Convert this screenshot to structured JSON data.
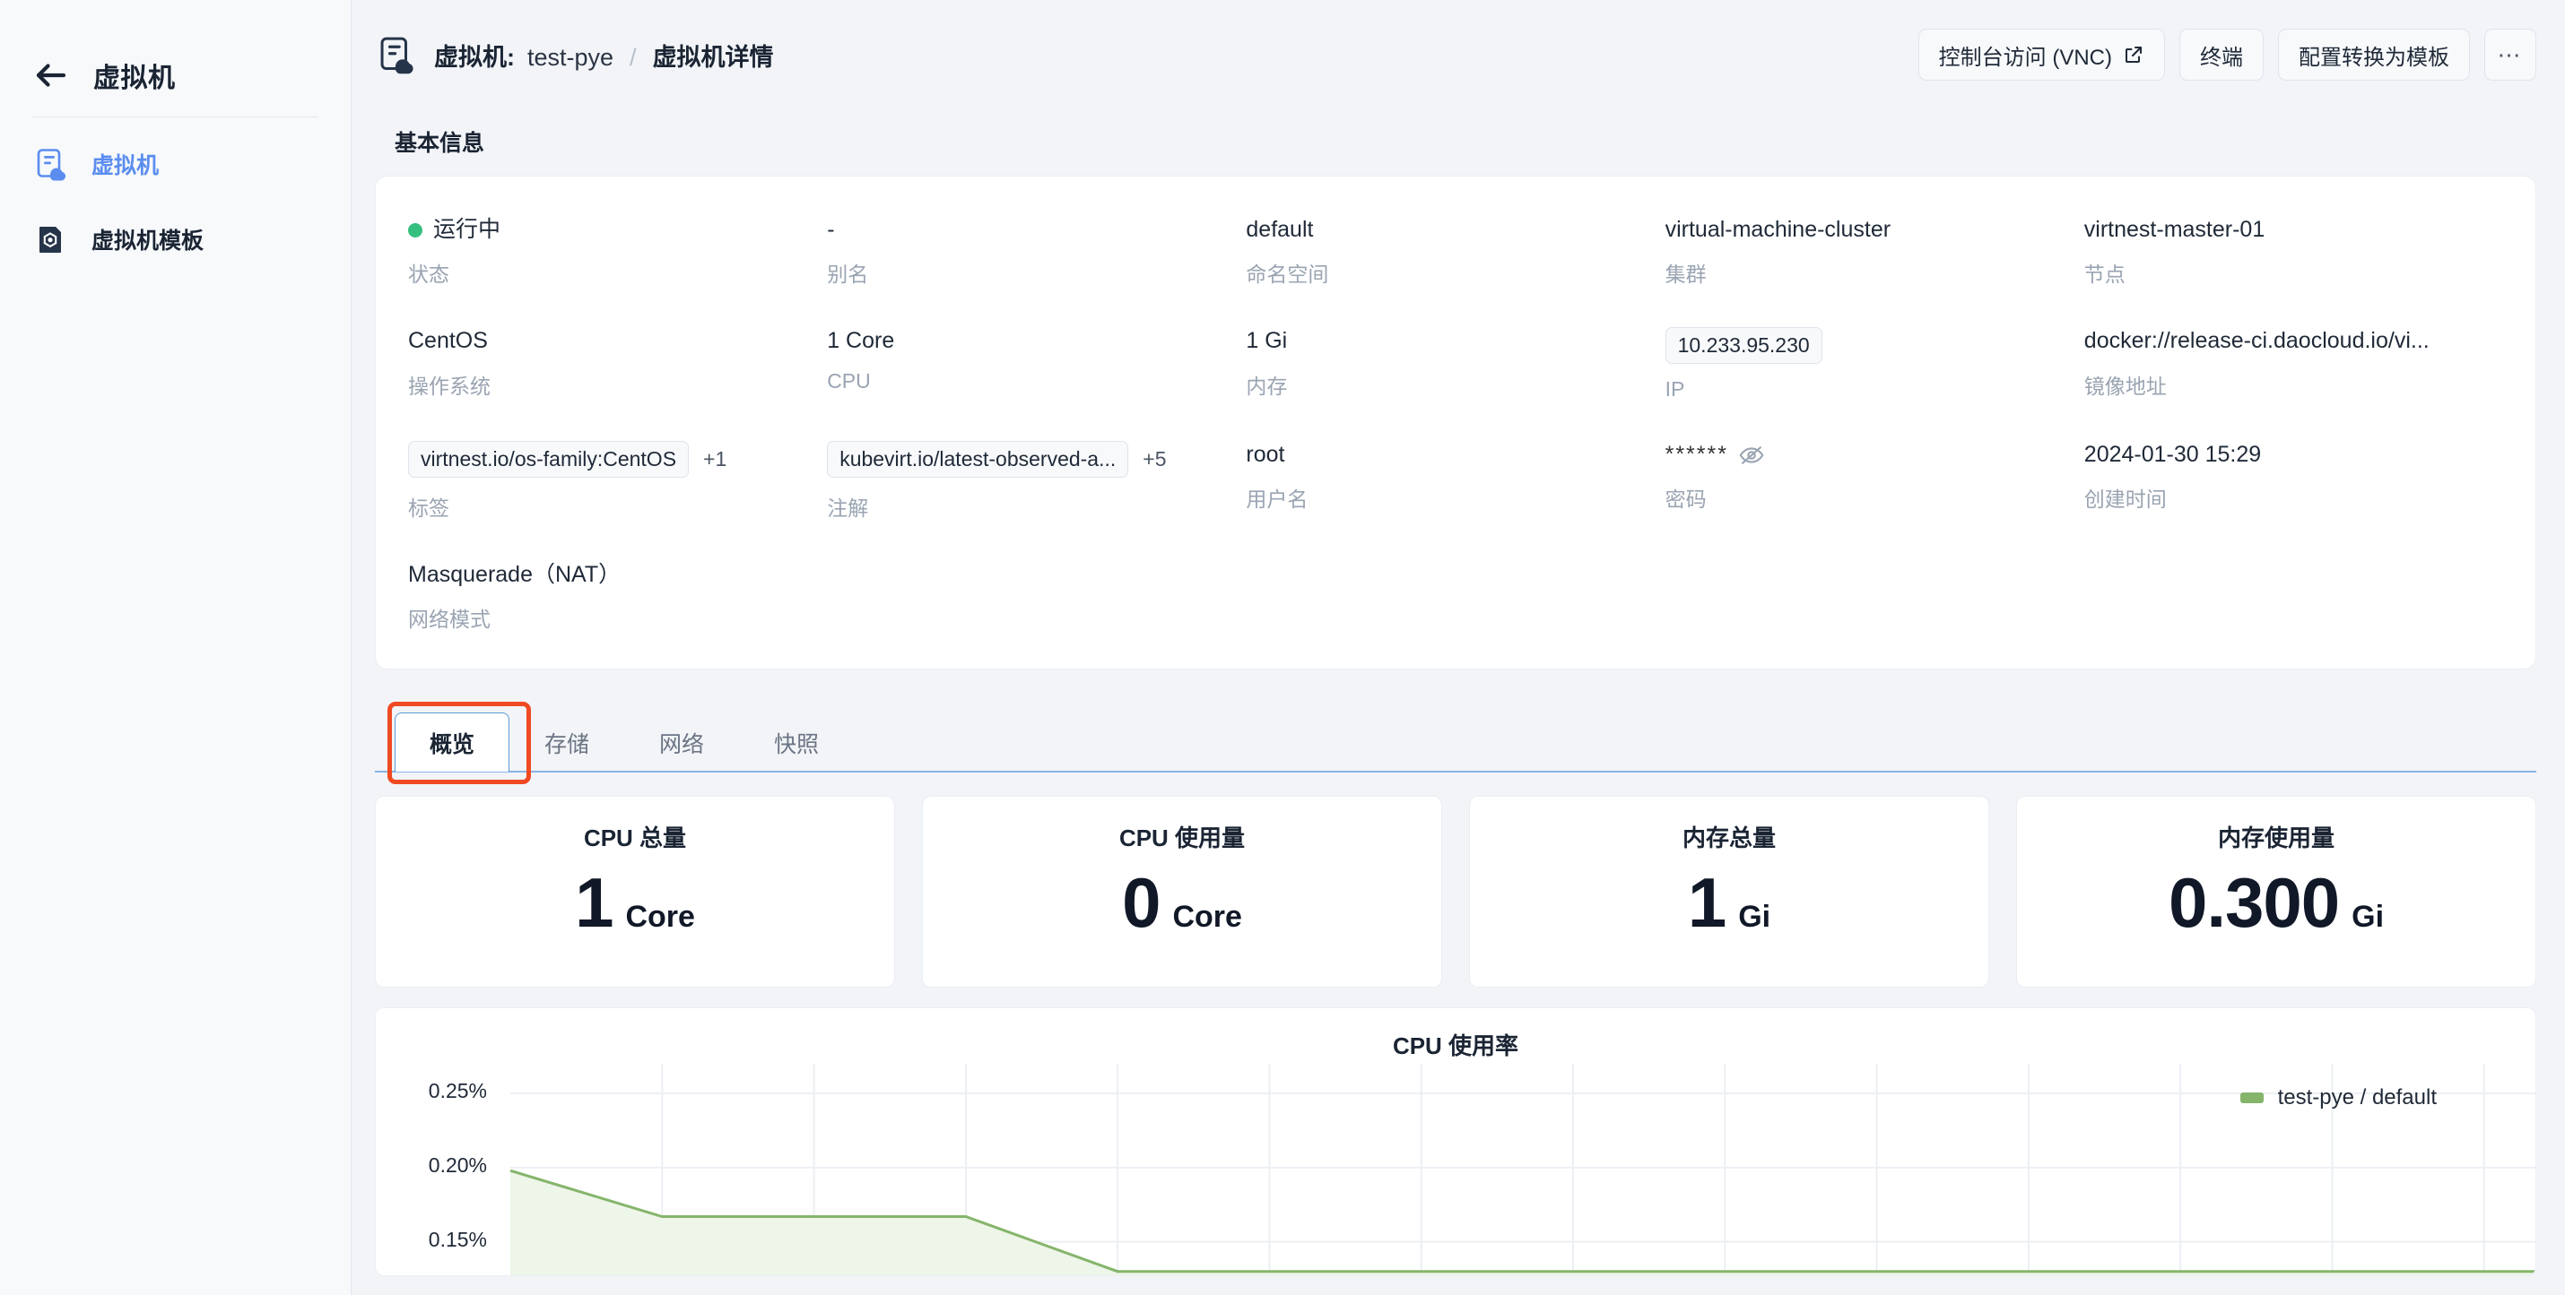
{
  "sidebar": {
    "back_icon": "arrow-left-icon",
    "title": "虚拟机",
    "items": [
      {
        "label": "虚拟机",
        "icon": "vm-cloud-icon",
        "active": true
      },
      {
        "label": "虚拟机模板",
        "icon": "vm-template-icon",
        "active": false
      }
    ]
  },
  "header": {
    "icon": "vm-cloud-icon",
    "breadcrumb": {
      "prefix": "虚拟机:",
      "name": "test-pye",
      "separator": "/",
      "current": "虚拟机详情"
    },
    "actions": {
      "vnc": "控制台访问 (VNC)",
      "vnc_icon": "external-link-icon",
      "terminal": "终端",
      "convert_template": "配置转换为模板",
      "more": "⋯",
      "more_icon": "ellipsis-icon"
    }
  },
  "basic_info": {
    "section_title": "基本信息",
    "fields": [
      {
        "value": "运行中",
        "label": "状态",
        "kind": "status",
        "status_color": "#35c07f"
      },
      {
        "value": "-",
        "label": "别名",
        "kind": "text"
      },
      {
        "value": "default",
        "label": "命名空间",
        "kind": "text"
      },
      {
        "value": "virtual-machine-cluster",
        "label": "集群",
        "kind": "text"
      },
      {
        "value": "virtnest-master-01",
        "label": "节点",
        "kind": "text"
      },
      {
        "value": "CentOS",
        "label": "操作系统",
        "kind": "text"
      },
      {
        "value": "1 Core",
        "label": "CPU",
        "kind": "text"
      },
      {
        "value": "1 Gi",
        "label": "内存",
        "kind": "text"
      },
      {
        "value": "10.233.95.230",
        "label": "IP",
        "kind": "chip"
      },
      {
        "value": "docker://release-ci.daocloud.io/vi...",
        "label": "镜像地址",
        "kind": "text"
      },
      {
        "value": "virtnest.io/os-family:CentOS",
        "extra": "+1",
        "label": "标签",
        "kind": "chip_extra"
      },
      {
        "value": "kubevirt.io/latest-observed-a...",
        "extra": "+5",
        "label": "注解",
        "kind": "chip_extra"
      },
      {
        "value": "root",
        "label": "用户名",
        "kind": "text"
      },
      {
        "value": "******",
        "label": "密码",
        "kind": "password",
        "toggle_icon": "eye-off-icon"
      },
      {
        "value": "2024-01-30 15:29",
        "label": "创建时间",
        "kind": "text"
      },
      {
        "value": "Masquerade（NAT）",
        "label": "网络模式",
        "kind": "text"
      }
    ]
  },
  "tabs": [
    {
      "label": "概览",
      "active": true,
      "annotated": true
    },
    {
      "label": "存储",
      "active": false
    },
    {
      "label": "网络",
      "active": false
    },
    {
      "label": "快照",
      "active": false
    }
  ],
  "stats": [
    {
      "title": "CPU 总量",
      "number": "1",
      "unit": "Core"
    },
    {
      "title": "CPU 使用量",
      "number": "0",
      "unit": "Core"
    },
    {
      "title": "内存总量",
      "number": "1",
      "unit": "Gi"
    },
    {
      "title": "内存使用量",
      "number": "0.300",
      "unit": "Gi"
    }
  ],
  "chart_data": {
    "type": "area",
    "title": "CPU 使用率",
    "xlabel": "",
    "ylabel": "",
    "ylim": [
      0.125,
      0.27
    ],
    "yticks": [
      "0.25%",
      "0.20%",
      "0.15%"
    ],
    "ytick_values": [
      0.25,
      0.2,
      0.15
    ],
    "grid": true,
    "legend_position": "right",
    "series": [
      {
        "name": "test-pye / default",
        "color": "#85b56b",
        "fill": "#eef5e9",
        "x": [
          0,
          1,
          2,
          3,
          4,
          5,
          6,
          7,
          8,
          9,
          10,
          11,
          12,
          13,
          14
        ],
        "values": [
          0.198,
          0.167,
          0.167,
          0.167,
          0.13,
          0.13,
          0.13,
          0.13,
          0.13,
          0.13,
          0.13,
          0.13,
          0.13,
          0.13,
          0.13
        ]
      }
    ]
  },
  "colors": {
    "accent": "#5b8def",
    "status_running": "#35c07f",
    "annotation": "#f04a23",
    "tab_active_border": "#5b9bd5",
    "chart_line": "#85b56b",
    "page_bg": "#f2f4f7"
  }
}
